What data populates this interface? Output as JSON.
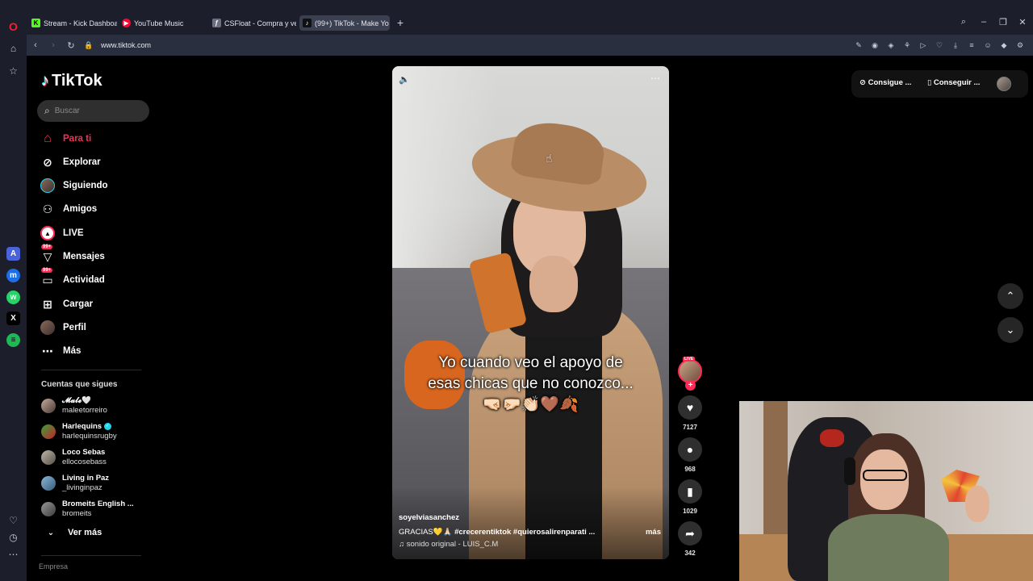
{
  "browser": {
    "tabs": [
      {
        "label": "Stream - Kick Dashboard",
        "fav_color": "#53fc18",
        "fav_glyph": "K"
      },
      {
        "label": "YouTube Music",
        "fav_color": "#ff0033",
        "fav_glyph": "▶"
      },
      {
        "label": "CSFloat - Compra y vende",
        "fav_color": "#6b6f80",
        "fav_glyph": "ƒ"
      },
      {
        "label": "(99+) TikTok - Make Yo",
        "fav_color": "#111111",
        "fav_glyph": "♪",
        "active": true
      }
    ],
    "url": "www.tiktok.com"
  },
  "tiktok": {
    "logo_text": "TikTok",
    "search_placeholder": "Buscar",
    "nav": [
      {
        "label": "Para ti",
        "icon": "home-icon",
        "active": true
      },
      {
        "label": "Explorar",
        "icon": "compass-icon"
      },
      {
        "label": "Siguiendo",
        "icon": "following-avatar"
      },
      {
        "label": "Amigos",
        "icon": "friends-icon"
      },
      {
        "label": "LIVE",
        "icon": "live-icon"
      },
      {
        "label": "Mensajes",
        "icon": "messages-icon",
        "badge": "99+"
      },
      {
        "label": "Actividad",
        "icon": "activity-icon",
        "badge": "99+"
      },
      {
        "label": "Cargar",
        "icon": "upload-icon"
      },
      {
        "label": "Perfil",
        "icon": "profile-avatar"
      },
      {
        "label": "Más",
        "icon": "more-icon"
      }
    ],
    "following_title": "Cuentas que sigues",
    "following": [
      {
        "name": "𝓜𝓪𝓵𝓮🤍",
        "user": "maleetorreiro"
      },
      {
        "name": "Harlequins",
        "user": "harlequinsrugby",
        "verified": true
      },
      {
        "name": "Loco Sebas",
        "user": "ellocosebass"
      },
      {
        "name": "Living in Paz",
        "user": "_livinginpaz"
      },
      {
        "name": "Bromeits English ...",
        "user": "bromeits"
      }
    ],
    "see_more": "Ver más",
    "footer_section": "Empresa",
    "header_buttons": {
      "coins": "Consigue ...",
      "app": "Conseguir ..."
    },
    "video": {
      "caption": "Yo cuando veo el apoyo de esas chicas que no conozco...🤜🏻🤛🏻👏🏻🤎🍂",
      "author": "soyelviasanchez",
      "description_prefix": "GRACIAS💛🙏🏻",
      "hashtags": "#crecerentiktok #quierosalirenparati ...",
      "more": "más",
      "sound": "sonido original - LUIS_C.M",
      "live_badge": "LIVE"
    },
    "actions": [
      {
        "icon": "heart-icon",
        "count": "7127"
      },
      {
        "icon": "comment-icon",
        "count": "968"
      },
      {
        "icon": "bookmark-icon",
        "count": "1029"
      },
      {
        "icon": "share-icon",
        "count": "342"
      }
    ]
  }
}
